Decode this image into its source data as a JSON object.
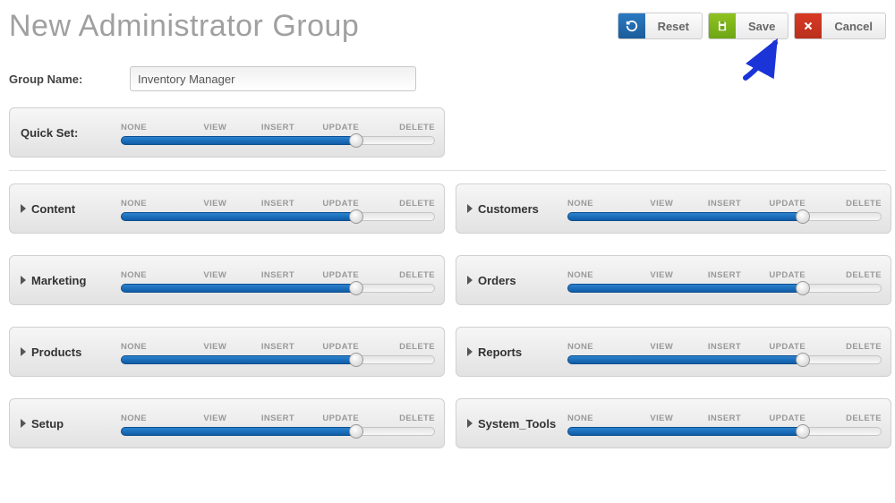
{
  "title": "New Administrator Group",
  "toolbar": {
    "reset": "Reset",
    "save": "Save",
    "cancel": "Cancel"
  },
  "form": {
    "group_name_label": "Group Name:",
    "group_name_value": "Inventory Manager"
  },
  "slider_steps": [
    "NONE",
    "VIEW",
    "INSERT",
    "UPDATE",
    "DELETE"
  ],
  "quickset": {
    "label": "Quick Set:",
    "value": "UPDATE",
    "value_index": 3
  },
  "sections": [
    {
      "label": "Content",
      "value": "UPDATE",
      "value_index": 3
    },
    {
      "label": "Customers",
      "value": "UPDATE",
      "value_index": 3
    },
    {
      "label": "Marketing",
      "value": "UPDATE",
      "value_index": 3
    },
    {
      "label": "Orders",
      "value": "UPDATE",
      "value_index": 3
    },
    {
      "label": "Products",
      "value": "UPDATE",
      "value_index": 3
    },
    {
      "label": "Reports",
      "value": "UPDATE",
      "value_index": 3
    },
    {
      "label": "Setup",
      "value": "UPDATE",
      "value_index": 3
    },
    {
      "label": "System_Tools",
      "value": "UPDATE",
      "value_index": 3
    }
  ],
  "colors": {
    "reset_icon_bg": "#1c5c9a",
    "save_icon_bg": "#6ea515",
    "cancel_icon_bg": "#b9301d",
    "slider_fill": "#0f5ca6",
    "arrow": "#1a34d8"
  },
  "annotation": {
    "arrow_target": "save-button"
  }
}
